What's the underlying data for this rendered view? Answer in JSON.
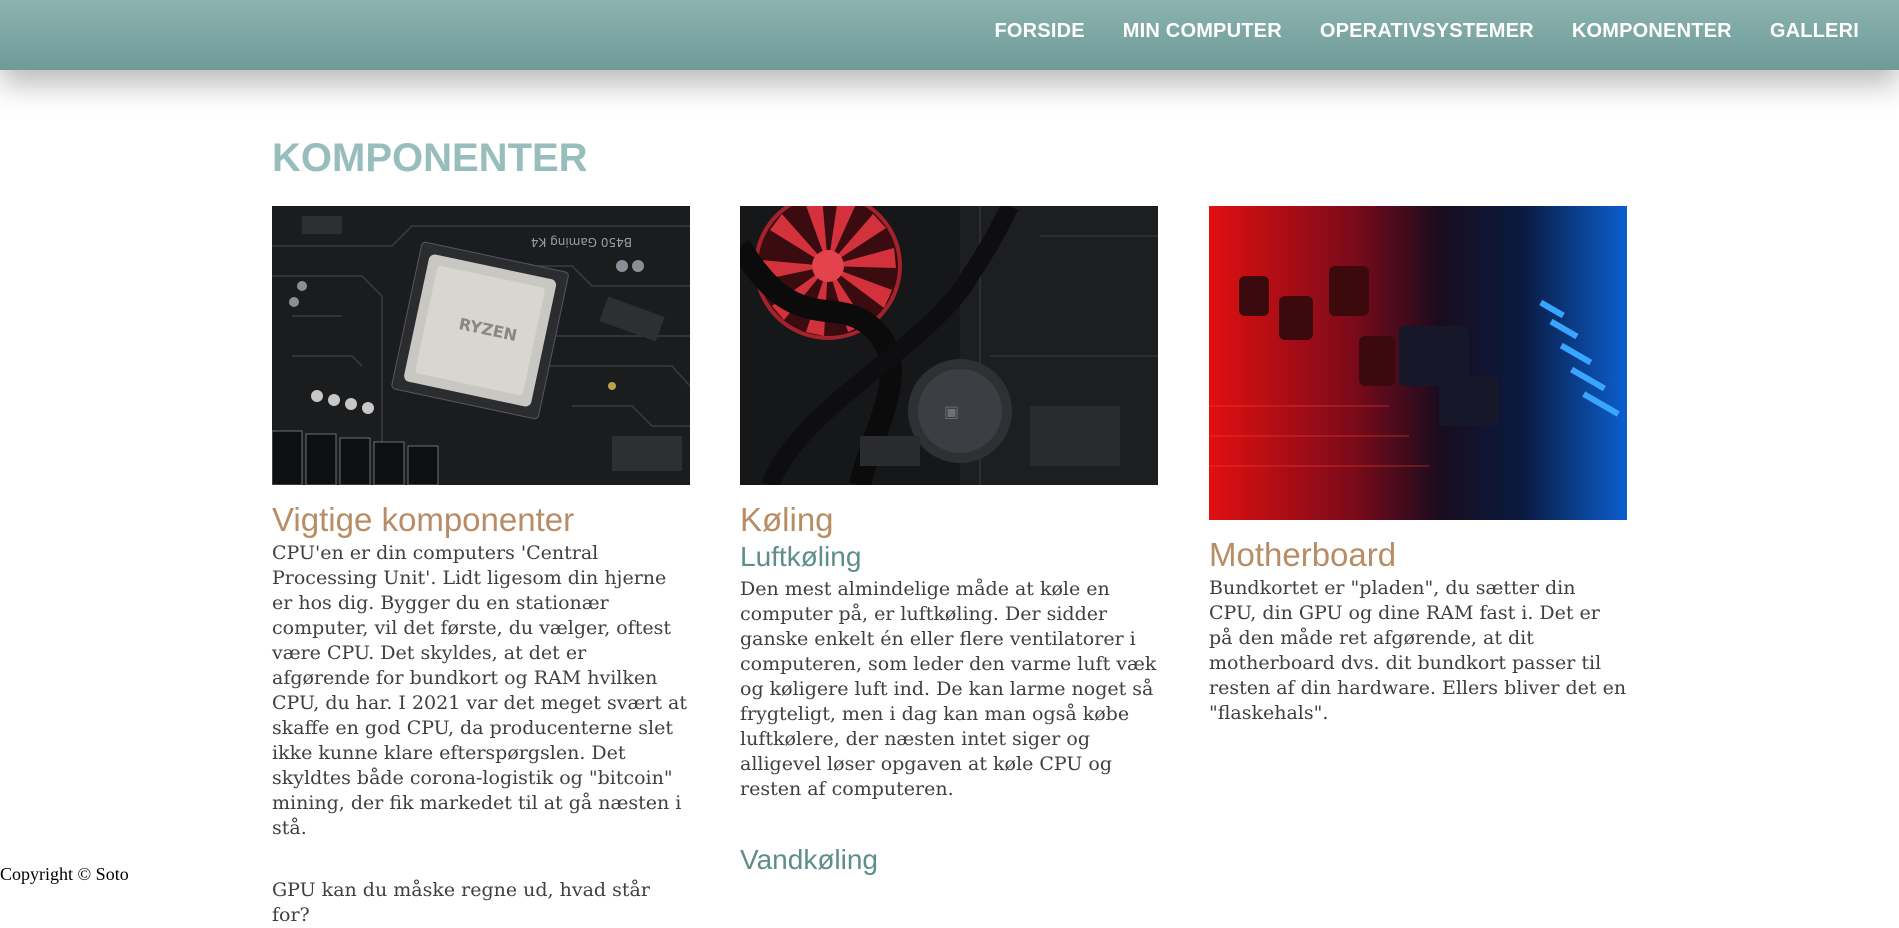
{
  "nav": {
    "items": [
      "FORSIDE",
      "MIN COMPUTER",
      "OPERATIVSYSTEMER",
      "KOMPONENTER",
      "GALLERI"
    ]
  },
  "page": {
    "title": "KOMPONENTER"
  },
  "columns": [
    {
      "image": "cpu-on-motherboard-photo",
      "heading": "Vigtige komponenter",
      "body": "CPU'en er din computers 'Central Processing Unit'. Lidt ligesom din hjerne er hos dig. Bygger du en stationær computer, vil det første, du vælger, oftest være CPU. Det skyldes, at det er afgørende for bundkort og RAM hvilken CPU, du har. I 2021 var det meget svært at skaffe en god CPU, da producenterne slet ikke kunne klare efterspørgslen. Det skyldtes både corona-logistik og \"bitcoin\" mining, der fik markedet til at gå næsten i stå.",
      "body2": "GPU kan du måske regne ud, hvad står for?"
    },
    {
      "image": "red-fan-cooler-photo",
      "heading": "Køling",
      "subheading": "Luftkøling",
      "body": "Den mest almindelige måde at køle en computer på, er luftkøling. Der sidder ganske enkelt én eller flere ventilatorer i computeren, som leder den varme luft væk og køligere luft ind. De kan larme noget så frygteligt, men i dag kan man også købe luftkølere, der næsten intet siger og alligevel løser opgaven at køle CPU og resten af computeren.",
      "subheading2": "Vandkøling"
    },
    {
      "image": "motherboard-red-blue-photo",
      "heading": "Motherboard",
      "body": "Bundkortet er \"pladen\", du sætter din CPU, din GPU og dine RAM fast i. Det er på den måde ret afgørende, at dit motherboard dvs. dit bundkort passer til resten af din hardware. Ellers bliver det en \"flaskehals\"."
    }
  ],
  "footer": {
    "copyright": "Copyright © Soto"
  }
}
